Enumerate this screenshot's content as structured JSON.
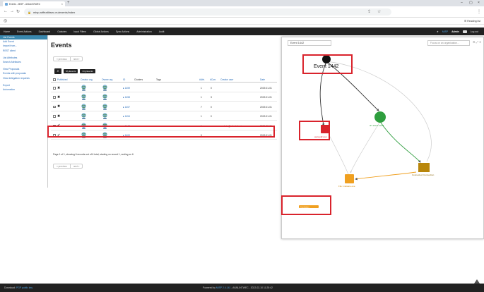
{
  "browser": {
    "tab_title": "Events - MISP - AVAILINTWEC",
    "url": "misp.arffealthsec.eu/events/index",
    "reading_list": "Reading list"
  },
  "nav": {
    "items": [
      "Home",
      "Event Actions",
      "Dashboard",
      "Galaxies",
      "Input Filters",
      "Global Actions",
      "Sync Actions",
      "Administration",
      "Audit"
    ],
    "org": "MISP",
    "user": "Admin",
    "logout": "Log out"
  },
  "sidebar": {
    "group1": [
      "List Events",
      "Add Event",
      "Import from...",
      "REST client"
    ],
    "group2": [
      "List Attributes",
      "Search Attributes"
    ],
    "group3": [
      "View Proposals",
      "Events with proposals",
      "View delegation requests"
    ],
    "group4": [
      "Export",
      "Automation"
    ]
  },
  "main": {
    "title": "Events",
    "prev": "« previous",
    "next": "next »",
    "my_events": "My Events",
    "org_events": "Org Events",
    "search_icon": "search-icon",
    "columns": [
      "Published",
      "Creator org",
      "Owner org",
      "ID",
      "Clusters",
      "Tags",
      "#Attr.",
      "#Corr.",
      "Creator user",
      "Date"
    ],
    "rows": [
      {
        "published": "✖",
        "id": "1459",
        "attr": "1",
        "corr": "0",
        "user": "",
        "date": "2019-01-01"
      },
      {
        "published": "✖",
        "id": "1458",
        "attr": "1",
        "corr": "3",
        "user": "",
        "date": "2019-01-01"
      },
      {
        "published": "✖",
        "id": "1457",
        "attr": "7",
        "corr": "0",
        "user": "",
        "date": "2019-01-01"
      },
      {
        "published": "✖",
        "id": "1454",
        "attr": "1",
        "corr": "0",
        "user": "",
        "date": "2019-01-01"
      },
      {
        "published": "✔",
        "id": "1442",
        "attr": "1",
        "corr": "",
        "user": "admin@admin.test",
        "date": "2021-09-06"
      },
      {
        "published": "✔",
        "id": "1400",
        "attr": "0",
        "corr": "",
        "user": "",
        "date": "2019-01-01"
      }
    ],
    "info": "Page 1 of 1, showing 6 records out of 6 total, starting on record 1, ending on 6"
  },
  "graph": {
    "title_input": "Event 1442",
    "select_placeholder": "Focus on an organisation...",
    "root_label": "Event 1442",
    "node_labels": {
      "red": "www.pdf.com",
      "green": "IP: 203.0.113.3",
      "orange": "File: malware.exe",
      "brown": "Connected: Connection",
      "tag": "Correlation"
    }
  },
  "colors": {
    "highlight": "#d9232c",
    "nav_bg": "#222222",
    "link": "#2a6ebb",
    "node_green": "#2e9e3e",
    "node_orange": "#f0a020",
    "node_brown": "#b8860b",
    "node_red": "#d9232c"
  },
  "footer": {
    "download": "Download: ",
    "download_link": "PGP public key",
    "powered": "Powered by ",
    "powered_link": "MISP 2.4.141",
    "powered_rest": " - AVAILINTWEC - 2022-02-10 11:25:42"
  }
}
